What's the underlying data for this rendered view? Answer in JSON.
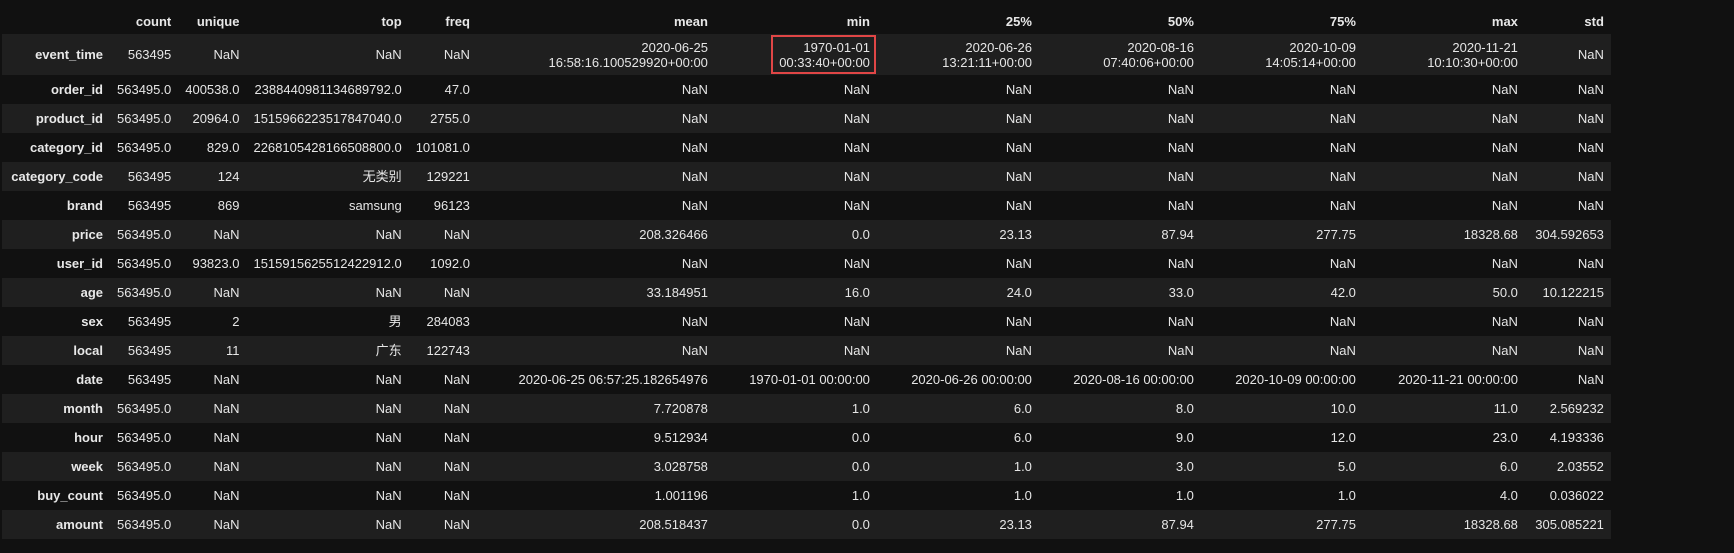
{
  "columns": [
    "count",
    "unique",
    "top",
    "freq",
    "mean",
    "min",
    "25%",
    "50%",
    "75%",
    "max",
    "std"
  ],
  "rows": [
    {
      "index": "event_time",
      "cells": [
        "563495",
        "NaN",
        "NaN",
        "NaN",
        [
          "2020-06-25",
          "16:58:16.100529920+00:00"
        ],
        [
          "1970-01-01",
          "00:33:40+00:00"
        ],
        [
          "2020-06-26",
          "13:21:11+00:00"
        ],
        [
          "2020-08-16",
          "07:40:06+00:00"
        ],
        [
          "2020-10-09",
          "14:05:14+00:00"
        ],
        [
          "2020-11-21",
          "10:10:30+00:00"
        ],
        "NaN"
      ]
    },
    {
      "index": "order_id",
      "cells": [
        "563495.0",
        "400538.0",
        "2388440981134689792.0",
        "47.0",
        "NaN",
        "NaN",
        "NaN",
        "NaN",
        "NaN",
        "NaN",
        "NaN"
      ]
    },
    {
      "index": "product_id",
      "cells": [
        "563495.0",
        "20964.0",
        "1515966223517847040.0",
        "2755.0",
        "NaN",
        "NaN",
        "NaN",
        "NaN",
        "NaN",
        "NaN",
        "NaN"
      ]
    },
    {
      "index": "category_id",
      "cells": [
        "563495.0",
        "829.0",
        "2268105428166508800.0",
        "101081.0",
        "NaN",
        "NaN",
        "NaN",
        "NaN",
        "NaN",
        "NaN",
        "NaN"
      ]
    },
    {
      "index": "category_code",
      "cells": [
        "563495",
        "124",
        "无类别",
        "129221",
        "NaN",
        "NaN",
        "NaN",
        "NaN",
        "NaN",
        "NaN",
        "NaN"
      ]
    },
    {
      "index": "brand",
      "cells": [
        "563495",
        "869",
        "samsung",
        "96123",
        "NaN",
        "NaN",
        "NaN",
        "NaN",
        "NaN",
        "NaN",
        "NaN"
      ]
    },
    {
      "index": "price",
      "cells": [
        "563495.0",
        "NaN",
        "NaN",
        "NaN",
        "208.326466",
        "0.0",
        "23.13",
        "87.94",
        "277.75",
        "18328.68",
        "304.592653"
      ]
    },
    {
      "index": "user_id",
      "cells": [
        "563495.0",
        "93823.0",
        "1515915625512422912.0",
        "1092.0",
        "NaN",
        "NaN",
        "NaN",
        "NaN",
        "NaN",
        "NaN",
        "NaN"
      ]
    },
    {
      "index": "age",
      "cells": [
        "563495.0",
        "NaN",
        "NaN",
        "NaN",
        "33.184951",
        "16.0",
        "24.0",
        "33.0",
        "42.0",
        "50.0",
        "10.122215"
      ]
    },
    {
      "index": "sex",
      "cells": [
        "563495",
        "2",
        "男",
        "284083",
        "NaN",
        "NaN",
        "NaN",
        "NaN",
        "NaN",
        "NaN",
        "NaN"
      ]
    },
    {
      "index": "local",
      "cells": [
        "563495",
        "11",
        "广东",
        "122743",
        "NaN",
        "NaN",
        "NaN",
        "NaN",
        "NaN",
        "NaN",
        "NaN"
      ]
    },
    {
      "index": "date",
      "cells": [
        "563495",
        "NaN",
        "NaN",
        "NaN",
        "2020-06-25 06:57:25.182654976",
        "1970-01-01 00:00:00",
        "2020-06-26 00:00:00",
        "2020-08-16 00:00:00",
        "2020-10-09 00:00:00",
        "2020-11-21 00:00:00",
        "NaN"
      ]
    },
    {
      "index": "month",
      "cells": [
        "563495.0",
        "NaN",
        "NaN",
        "NaN",
        "7.720878",
        "1.0",
        "6.0",
        "8.0",
        "10.0",
        "11.0",
        "2.569232"
      ]
    },
    {
      "index": "hour",
      "cells": [
        "563495.0",
        "NaN",
        "NaN",
        "NaN",
        "9.512934",
        "0.0",
        "6.0",
        "9.0",
        "12.0",
        "23.0",
        "4.193336"
      ]
    },
    {
      "index": "week",
      "cells": [
        "563495.0",
        "NaN",
        "NaN",
        "NaN",
        "3.028758",
        "0.0",
        "1.0",
        "3.0",
        "5.0",
        "6.0",
        "2.03552"
      ]
    },
    {
      "index": "buy_count",
      "cells": [
        "563495.0",
        "NaN",
        "NaN",
        "NaN",
        "1.001196",
        "1.0",
        "1.0",
        "1.0",
        "1.0",
        "4.0",
        "0.036022"
      ]
    },
    {
      "index": "amount",
      "cells": [
        "563495.0",
        "NaN",
        "NaN",
        "NaN",
        "208.518437",
        "0.0",
        "23.13",
        "87.94",
        "277.75",
        "18328.68",
        "305.085221"
      ]
    }
  ],
  "highlight": {
    "row": 0,
    "col": 5,
    "color": "#e04646"
  },
  "colors": {
    "background": "#111111",
    "row_alt": "#1f1f1f",
    "text": "#e6e6e6",
    "highlight_border": "#e04646"
  }
}
